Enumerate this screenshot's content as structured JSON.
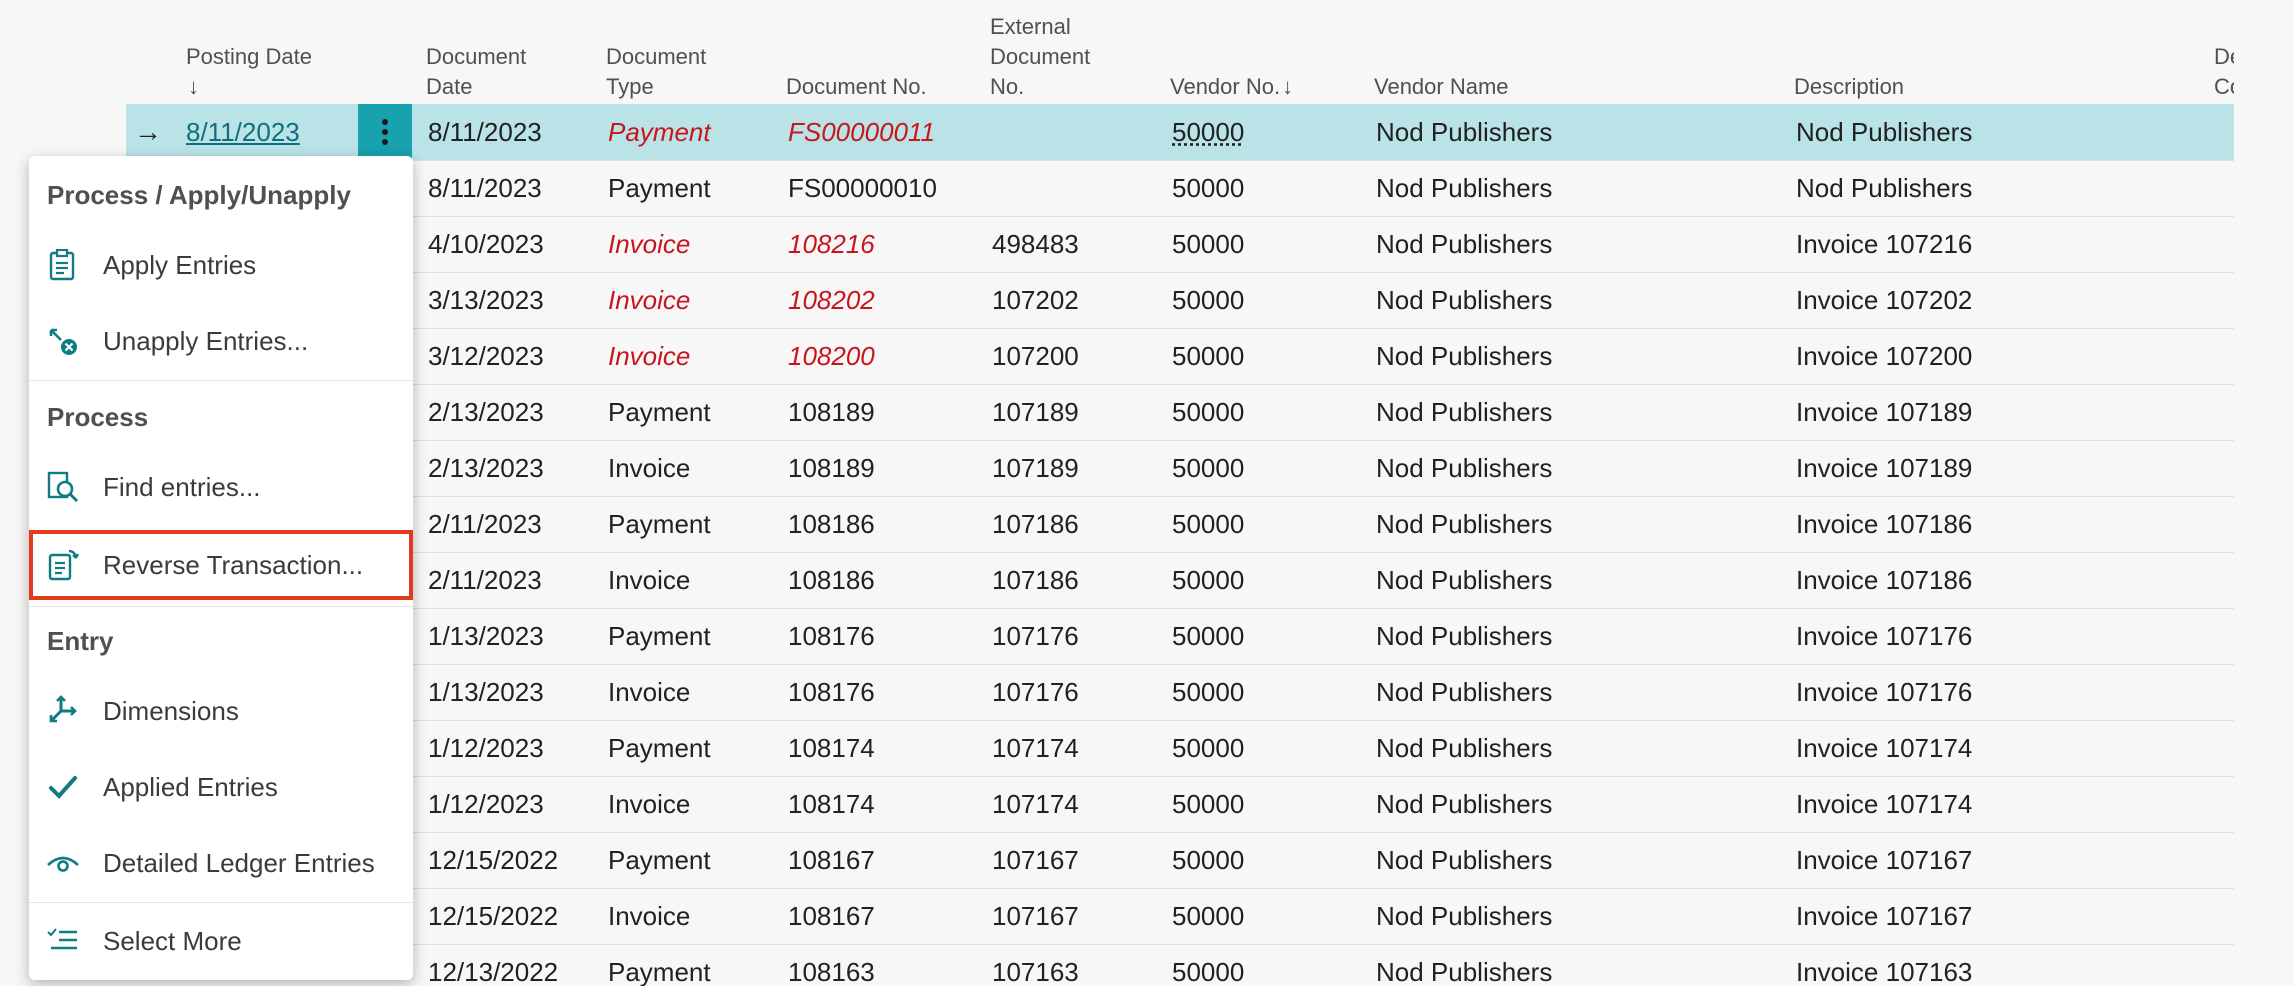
{
  "columns": {
    "posting_date": "Posting Date",
    "posting_date_sort": "↓",
    "document_date_1": "Document",
    "document_date_2": "Date",
    "document_type_1": "Document",
    "document_type_2": "Type",
    "document_no": "Document No.",
    "external_doc_1": "External",
    "external_doc_2": "Document",
    "external_doc_3": "No.",
    "vendor_no": "Vendor No.",
    "vendor_no_sort": "↓",
    "vendor_name": "Vendor Name",
    "description": "Description",
    "cut_col_1": "De",
    "cut_col_2": "Co"
  },
  "rows": [
    {
      "posting_date": "8/11/2023",
      "document_date": "8/11/2023",
      "document_type": "Payment",
      "document_no": "FS00000011",
      "external_no": "",
      "vendor_no": "50000",
      "vendor_name": "Nod Publishers",
      "description": "Nod Publishers"
    },
    {
      "posting_date": "",
      "document_date": "8/11/2023",
      "document_type": "Payment",
      "document_no": "FS00000010",
      "external_no": "",
      "vendor_no": "50000",
      "vendor_name": "Nod Publishers",
      "description": "Nod Publishers"
    },
    {
      "posting_date": "",
      "document_date": "4/10/2023",
      "document_type": "Invoice",
      "document_no": "108216",
      "external_no": "498483",
      "vendor_no": "50000",
      "vendor_name": "Nod Publishers",
      "description": "Invoice 107216"
    },
    {
      "posting_date": "",
      "document_date": "3/13/2023",
      "document_type": "Invoice",
      "document_no": "108202",
      "external_no": "107202",
      "vendor_no": "50000",
      "vendor_name": "Nod Publishers",
      "description": "Invoice 107202"
    },
    {
      "posting_date": "",
      "document_date": "3/12/2023",
      "document_type": "Invoice",
      "document_no": "108200",
      "external_no": "107200",
      "vendor_no": "50000",
      "vendor_name": "Nod Publishers",
      "description": "Invoice 107200"
    },
    {
      "posting_date": "",
      "document_date": "2/13/2023",
      "document_type": "Payment",
      "document_no": "108189",
      "external_no": "107189",
      "vendor_no": "50000",
      "vendor_name": "Nod Publishers",
      "description": "Invoice 107189"
    },
    {
      "posting_date": "",
      "document_date": "2/13/2023",
      "document_type": "Invoice",
      "document_no": "108189",
      "external_no": "107189",
      "vendor_no": "50000",
      "vendor_name": "Nod Publishers",
      "description": "Invoice 107189"
    },
    {
      "posting_date": "",
      "document_date": "2/11/2023",
      "document_type": "Payment",
      "document_no": "108186",
      "external_no": "107186",
      "vendor_no": "50000",
      "vendor_name": "Nod Publishers",
      "description": "Invoice 107186"
    },
    {
      "posting_date": "",
      "document_date": "2/11/2023",
      "document_type": "Invoice",
      "document_no": "108186",
      "external_no": "107186",
      "vendor_no": "50000",
      "vendor_name": "Nod Publishers",
      "description": "Invoice 107186"
    },
    {
      "posting_date": "",
      "document_date": "1/13/2023",
      "document_type": "Payment",
      "document_no": "108176",
      "external_no": "107176",
      "vendor_no": "50000",
      "vendor_name": "Nod Publishers",
      "description": "Invoice 107176"
    },
    {
      "posting_date": "",
      "document_date": "1/13/2023",
      "document_type": "Invoice",
      "document_no": "108176",
      "external_no": "107176",
      "vendor_no": "50000",
      "vendor_name": "Nod Publishers",
      "description": "Invoice 107176"
    },
    {
      "posting_date": "",
      "document_date": "1/12/2023",
      "document_type": "Payment",
      "document_no": "108174",
      "external_no": "107174",
      "vendor_no": "50000",
      "vendor_name": "Nod Publishers",
      "description": "Invoice 107174"
    },
    {
      "posting_date": "",
      "document_date": "1/12/2023",
      "document_type": "Invoice",
      "document_no": "108174",
      "external_no": "107174",
      "vendor_no": "50000",
      "vendor_name": "Nod Publishers",
      "description": "Invoice 107174"
    },
    {
      "posting_date": "",
      "document_date": "12/15/2022",
      "document_type": "Payment",
      "document_no": "108167",
      "external_no": "107167",
      "vendor_no": "50000",
      "vendor_name": "Nod Publishers",
      "description": "Invoice 107167"
    },
    {
      "posting_date": "",
      "document_date": "12/15/2022",
      "document_type": "Invoice",
      "document_no": "108167",
      "external_no": "107167",
      "vendor_no": "50000",
      "vendor_name": "Nod Publishers",
      "description": "Invoice 107167"
    },
    {
      "posting_date": "",
      "document_date": "12/13/2022",
      "document_type": "Payment",
      "document_no": "108163",
      "external_no": "107163",
      "vendor_no": "50000",
      "vendor_name": "Nod Publishers",
      "description": "Invoice 107163"
    }
  ],
  "menu": {
    "sections": [
      {
        "heading": "Process / Apply/Unapply",
        "items": [
          {
            "label": "Apply Entries",
            "icon": "apply-entries-icon"
          },
          {
            "label": "Unapply Entries...",
            "icon": "unapply-entries-icon"
          }
        ]
      },
      {
        "heading": "Process",
        "items": [
          {
            "label": "Find entries...",
            "icon": "find-entries-icon"
          },
          {
            "label": "Reverse Transaction...",
            "icon": "reverse-transaction-icon",
            "highlighted": true
          }
        ]
      },
      {
        "heading": "Entry",
        "items": [
          {
            "label": "Dimensions",
            "icon": "dimensions-icon"
          },
          {
            "label": "Applied Entries",
            "icon": "checkmark-icon"
          },
          {
            "label": "Detailed Ledger Entries",
            "icon": "eye-icon"
          }
        ]
      },
      {
        "heading": "",
        "items": [
          {
            "label": "Select More",
            "icon": "select-more-icon"
          }
        ]
      }
    ]
  },
  "colors": {
    "selected_row": "#b9e3e7",
    "accent": "#17a2ae",
    "error_red": "#c8161d",
    "highlight_outline": "#e53a1e"
  }
}
